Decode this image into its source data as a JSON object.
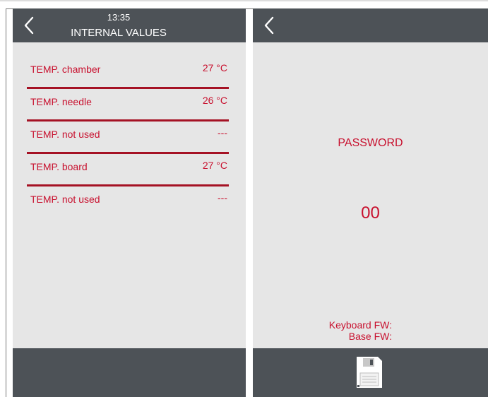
{
  "left_screen": {
    "time": "13:35",
    "title": "INTERNAL VALUES",
    "rows": [
      {
        "label": "TEMP. chamber",
        "value": "27 °C"
      },
      {
        "label": "TEMP. needle",
        "value": "26 °C"
      },
      {
        "label": "TEMP. not used",
        "value": "---"
      },
      {
        "label": "TEMP. board",
        "value": "27 °C"
      },
      {
        "label": "TEMP. not used",
        "value": "---"
      }
    ]
  },
  "right_screen": {
    "password_label": "PASSWORD",
    "password_value": "00",
    "keyboard_fw_label": "Keyboard FW:",
    "base_fw_label": "Base FW:"
  },
  "colors": {
    "header": "#4d5257",
    "panel": "#e6e6e6",
    "text_red": "#c8102e",
    "divider": "#a51224"
  },
  "icons": {
    "back": "chevron-left-icon",
    "save": "floppy-disk-icon"
  }
}
